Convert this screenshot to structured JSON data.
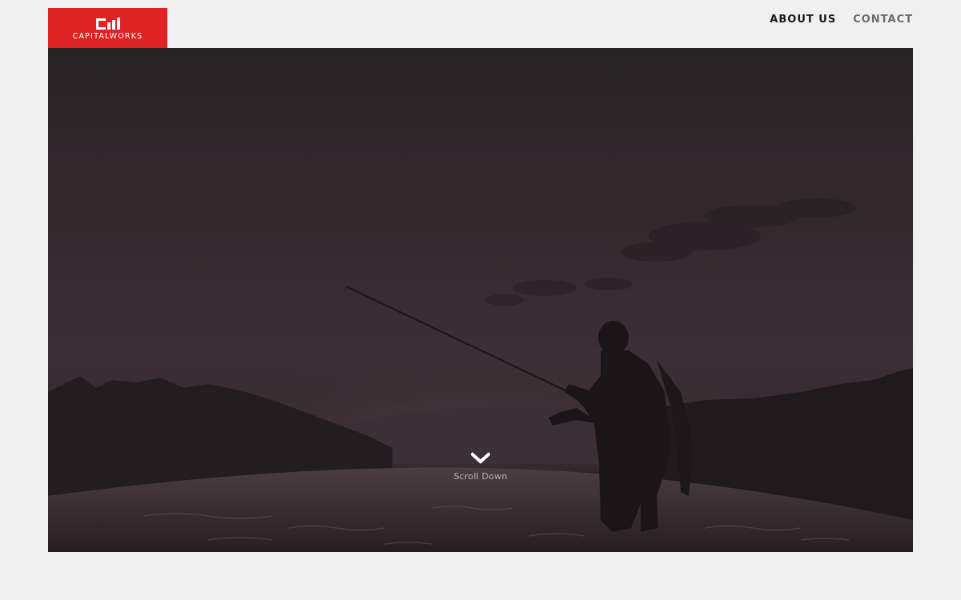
{
  "brand": {
    "name": "CAPITALWORKS",
    "color": "#dd2323",
    "logo_icon": "capitalworks-mark-icon"
  },
  "nav": {
    "items": [
      {
        "label": "ABOUT US"
      },
      {
        "label": "CONTACT"
      }
    ]
  },
  "hero": {
    "image_subject": "fly-fisherman-silhouette",
    "scroll": {
      "icon": "chevron-down-icon",
      "label": "Scroll Down"
    }
  }
}
